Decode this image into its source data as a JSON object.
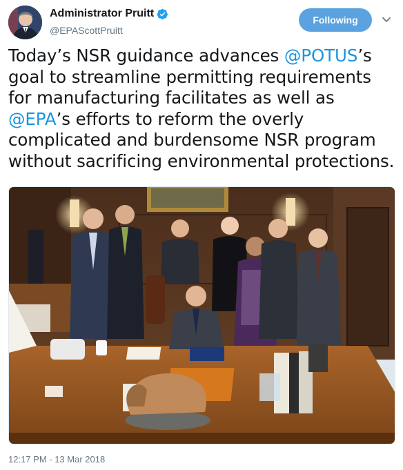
{
  "author": {
    "display_name": "Administrator Pruitt",
    "handle": "@EPAScottPruitt",
    "verified": true,
    "avatar_icon": "profile-avatar"
  },
  "actions": {
    "follow_label": "Following",
    "follow_color": "#5aa3e0",
    "more_icon": "chevron-down-icon"
  },
  "tweet": {
    "text_parts": {
      "p1": "Today’s NSR guidance advances ",
      "m1": "@POTUS",
      "p2": "’s goal to streamline permitting requirements for manufacturing facilitates as well as ",
      "m2": "@EPA",
      "p3": "’s efforts to reform the overly complicated and burdensome NSR program without sacrificing environmental protections."
    },
    "mention_color": "#1b95e0"
  },
  "media": {
    "kind": "photo"
  },
  "meta": {
    "timestamp": "12:17 PM - 13 Mar 2018"
  }
}
